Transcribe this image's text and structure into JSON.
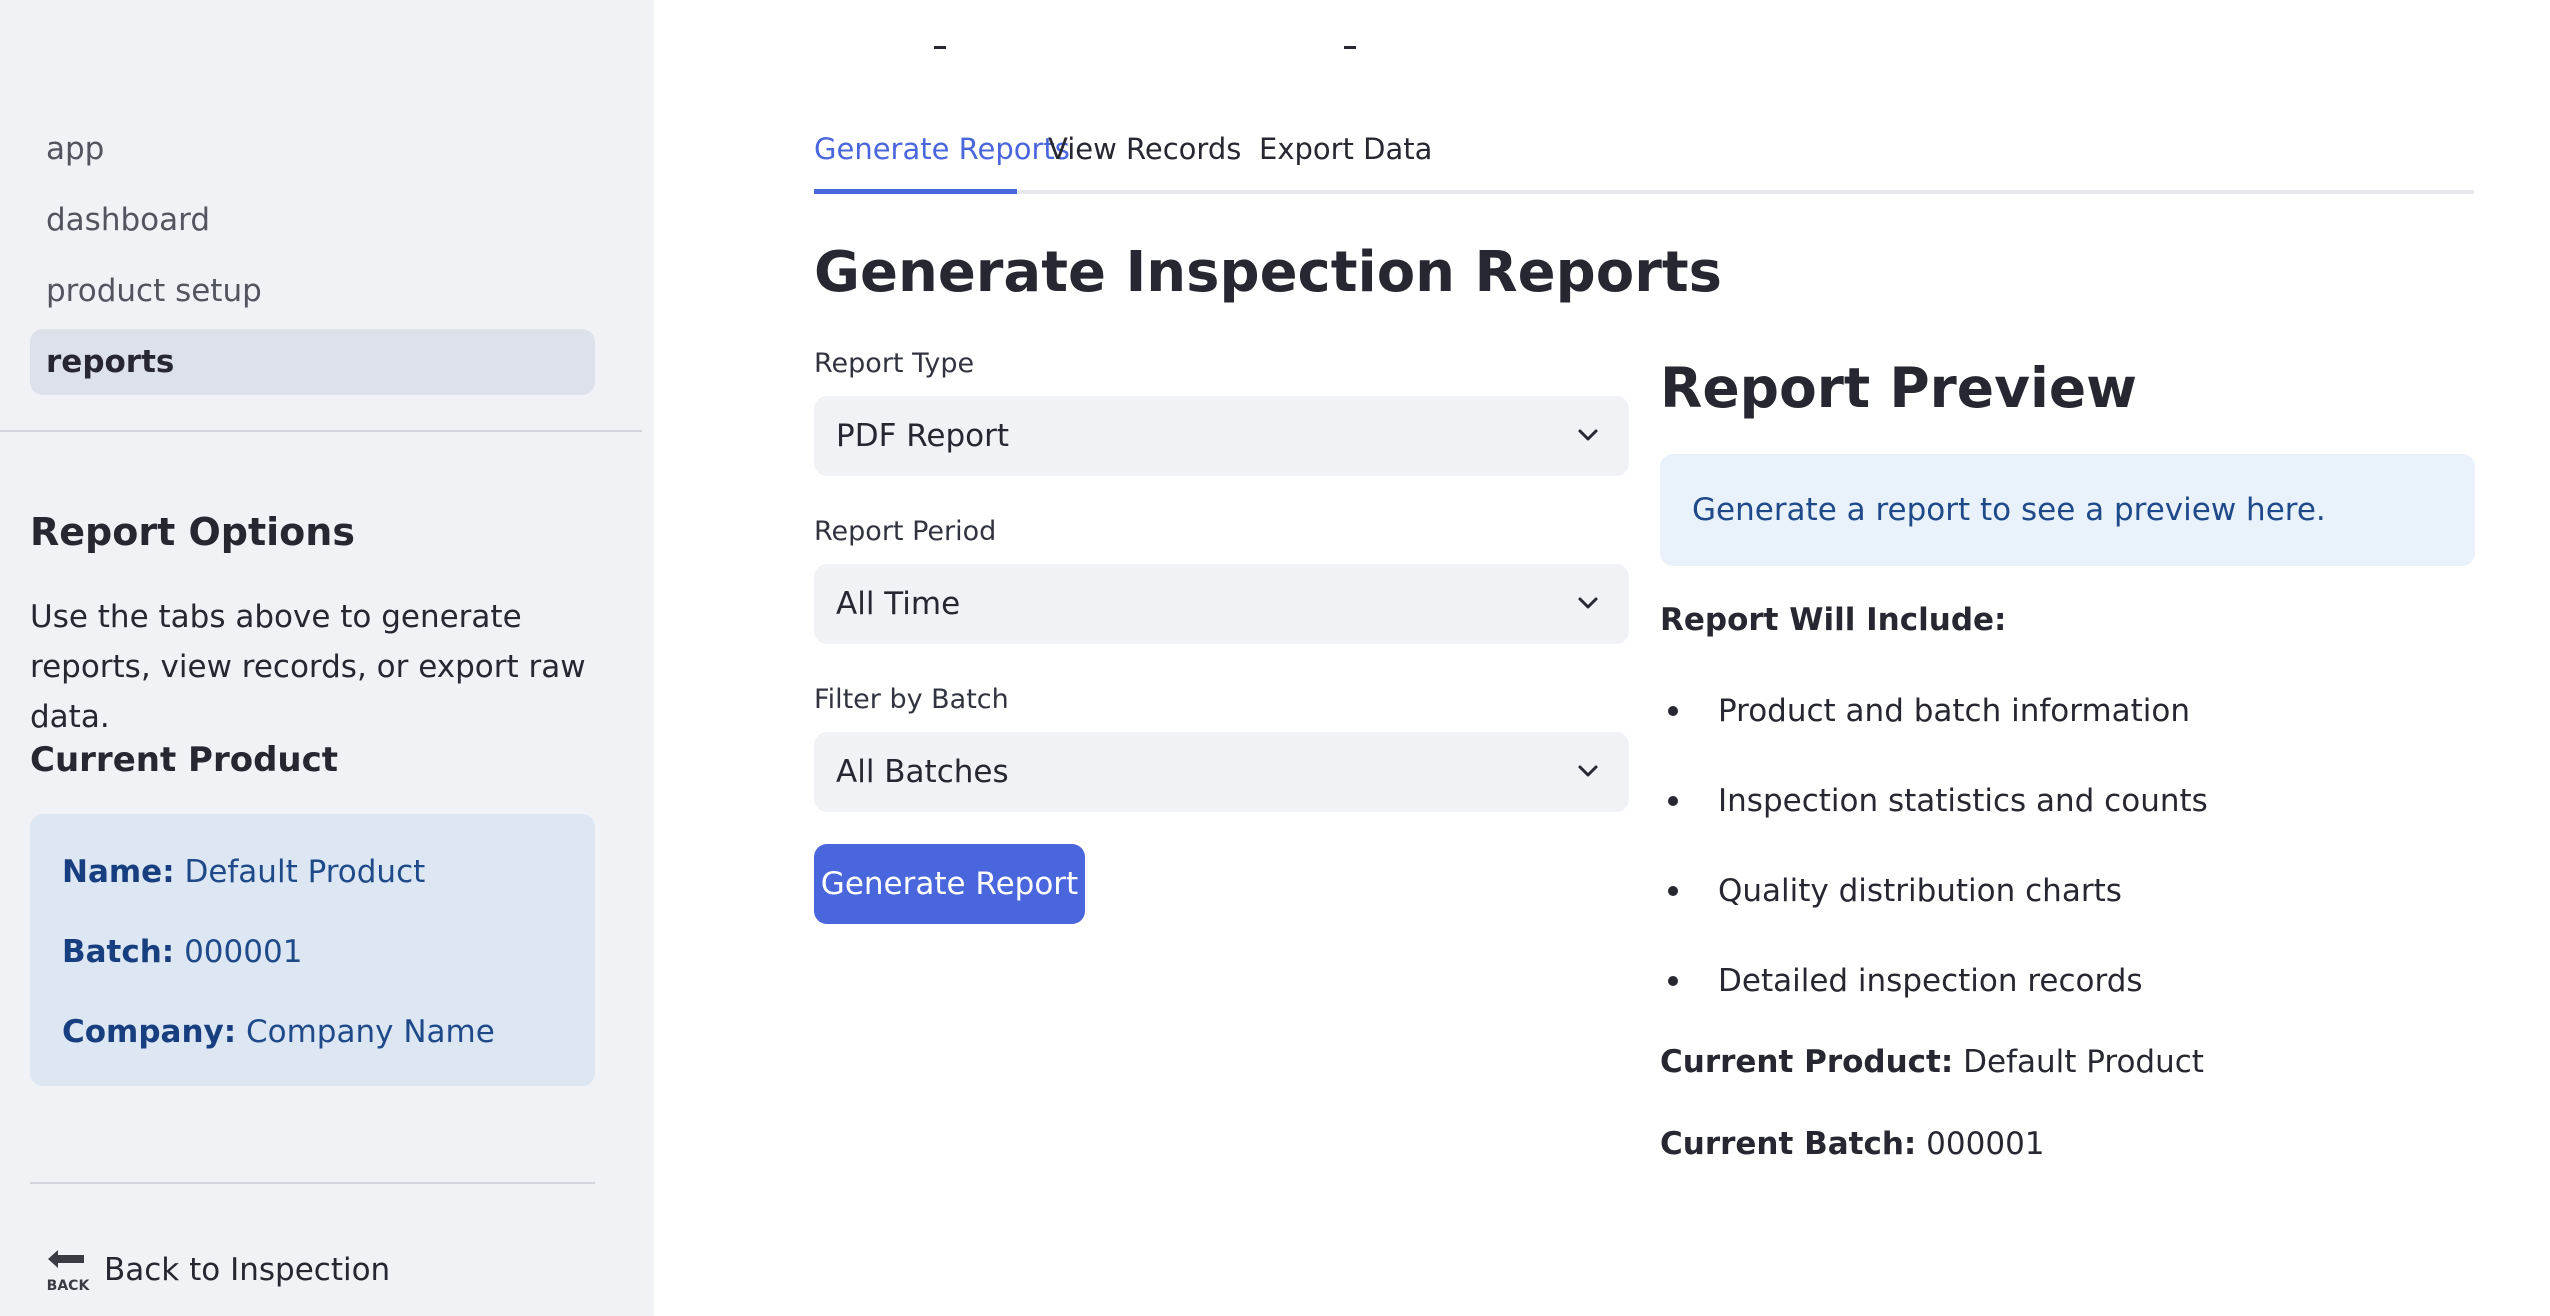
{
  "sidebar": {
    "nav": [
      {
        "label": "app"
      },
      {
        "label": "dashboard"
      },
      {
        "label": "product setup"
      },
      {
        "label": "reports"
      }
    ],
    "report_options_heading": "Report Options",
    "report_options_text": "Use the tabs above to generate reports, view records, or export raw data.",
    "current_product_heading": "Current Product",
    "product": {
      "name_label": "Name:",
      "name_value": "Default Product",
      "batch_label": "Batch:",
      "batch_value": "000001",
      "company_label": "Company:",
      "company_value": "Company Name"
    },
    "back_icon_text": "BACK",
    "back_label": "Back to Inspection"
  },
  "tabs": [
    {
      "label": "Generate Reports",
      "active": true
    },
    {
      "label": "View Records"
    },
    {
      "label": "Export Data"
    }
  ],
  "main": {
    "title": "Generate Inspection Reports",
    "report_type_label": "Report Type",
    "report_type_value": "PDF Report",
    "report_period_label": "Report Period",
    "report_period_value": "All Time",
    "filter_batch_label": "Filter by Batch",
    "filter_batch_value": "All Batches",
    "generate_button": "Generate Report"
  },
  "preview": {
    "title": "Report Preview",
    "info": "Generate a report to see a preview here.",
    "will_include": "Report Will Include:",
    "items": [
      "Product and batch information",
      "Inspection statistics and counts",
      "Quality distribution charts",
      "Detailed inspection records"
    ],
    "current_product_label": "Current Product:",
    "current_product_value": "Default Product",
    "current_batch_label": "Current Batch:",
    "current_batch_value": "000001"
  },
  "colors": {
    "accent": "#4a66dd",
    "sidebar_bg": "#f0f2f6",
    "info_bg": "#e9f1fb",
    "info_text": "#1f4a8a"
  }
}
